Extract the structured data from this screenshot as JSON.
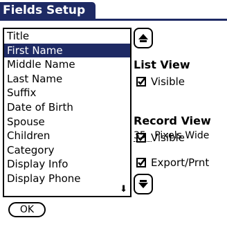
{
  "header": {
    "title": "Fields Setup"
  },
  "colors": {
    "accent": "#1e2a64"
  },
  "field_list": {
    "items": [
      "Title",
      "First Name",
      "Middle Name",
      "Last Name",
      "Suffix",
      "Date of Birth",
      "Spouse",
      "Children",
      "Category",
      "Display Info",
      "Display Phone"
    ],
    "selected": "First Name",
    "scroll_indicator": "down-arrow-icon"
  },
  "list_view": {
    "title": "List View",
    "visible_label": "Visible",
    "visible_checked": true,
    "pixels_value": "35",
    "pixels_label": "Pixels Wide"
  },
  "record_view": {
    "title": "Record View",
    "visible_label": "Visible",
    "visible_checked": true,
    "export_label": "Export/Prnt",
    "export_checked": true
  },
  "buttons": {
    "ok_label": "OK",
    "up_icon": "up-arrow-icon",
    "down_icon": "down-arrow-icon"
  }
}
